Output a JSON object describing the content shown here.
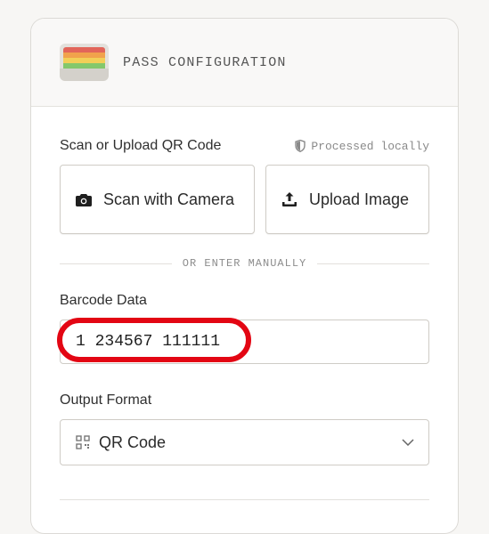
{
  "header": {
    "title": "PASS CONFIGURATION",
    "icon": "wallet-icon"
  },
  "scan": {
    "label": "Scan or Upload QR Code",
    "local_note": "Processed locally",
    "camera_button": "Scan with Camera",
    "upload_button": "Upload Image"
  },
  "divider": {
    "text": "OR ENTER MANUALLY"
  },
  "barcode": {
    "label": "Barcode Data",
    "value": "1 234567 111111"
  },
  "output": {
    "label": "Output Format",
    "selected": "QR Code"
  },
  "colors": {
    "highlight": "#e30613"
  }
}
